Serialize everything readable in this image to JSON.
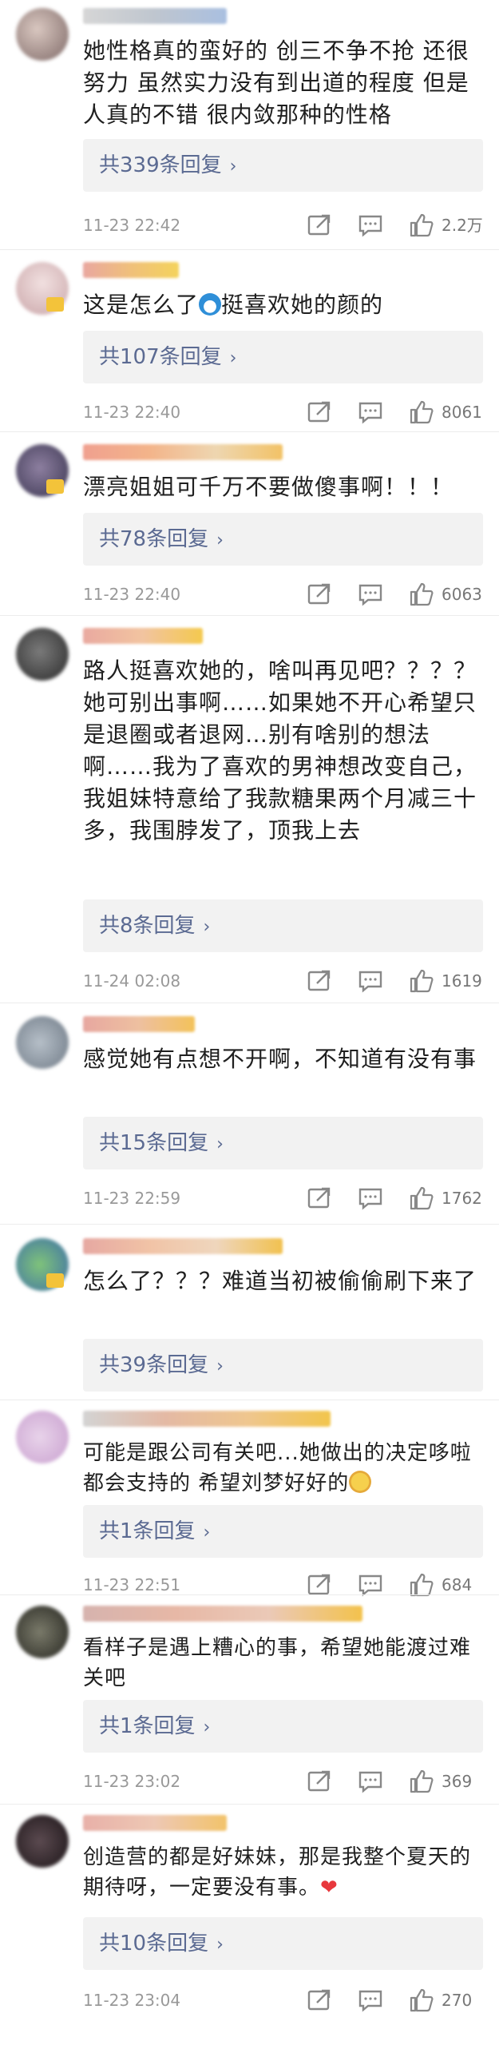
{
  "comments": [
    {
      "content": "她性格真的蛮好的 创三不争不抢 还很努力 虽然实力没有到出道的程度 但是人真的不错 很内敛那种的性格",
      "replies": "共339条回复",
      "time": "11-23 22:42",
      "likes": "2.2万"
    },
    {
      "content": "这是怎么了",
      "content_after_emoji": "挺喜欢她的颜的",
      "replies": "共107条回复",
      "time": "11-23 22:40",
      "likes": "8061"
    },
    {
      "content": "漂亮姐姐可千万不要做傻事啊！！！",
      "replies": "共78条回复",
      "time": "11-23 22:40",
      "likes": "6063"
    },
    {
      "content": "路人挺喜欢她的，啥叫再见吧？？？？她可别出事啊……如果她不开心希望只是退圈或者退网…别有啥别的想法啊……我为了喜欢的男神想改变自己，我姐妹特意给了我款糖果两个月减三十多，我围脖发了，顶我上去",
      "replies": "共8条回复",
      "time": "11-24 02:08",
      "likes": "1619"
    },
    {
      "content": "感觉她有点想不开啊，不知道有没有事",
      "replies": "共15条回复",
      "time": "11-23 22:59",
      "likes": "1762"
    },
    {
      "content": "怎么了？？？难道当初被偷偷刷下来了",
      "replies": "共39条回复",
      "time": "",
      "likes": ""
    },
    {
      "content": "可能是跟公司有关吧...她做出的决定哆啦都会支持的 希望刘梦好好的",
      "replies": "共1条回复",
      "time": "11-23 22:51",
      "likes": "684"
    },
    {
      "content": "看样子是遇上糟心的事，希望她能渡过难关吧",
      "replies": "共1条回复",
      "time": "11-23 23:02",
      "likes": "369"
    },
    {
      "content": "创造营的都是好妹妹，那是我整个夏天的期待呀，一定要没有事。",
      "replies": "共10条回复",
      "time": "11-23 23:04",
      "likes": "270"
    }
  ],
  "icons": {
    "share": "share-icon",
    "comment": "comment-icon",
    "like": "thumbs-up-icon",
    "chevron": "chevron-right-icon"
  },
  "colors": {
    "reply_link": "#5b6a92",
    "reply_bg": "#f2f2f2",
    "meta_text": "#999999",
    "heart": "#e8383d"
  }
}
